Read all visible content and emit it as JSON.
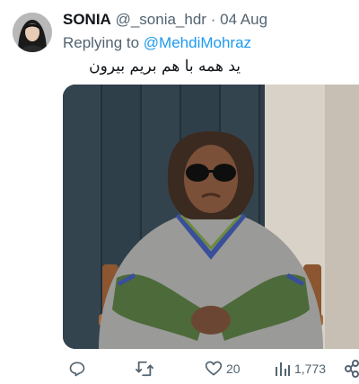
{
  "tweet": {
    "display_name": "SONIA",
    "handle": "@_sonia_hdr",
    "separator": "·",
    "date": "04 Aug",
    "replying_prefix": "Replying to",
    "replying_to": "@MehdiMohraz",
    "text": "ید همه با هم بریم بیرون",
    "media_icon": "photo-of-person-in-sunglasses-sitting-in-chair"
  },
  "actions": {
    "reply_icon": "reply-icon",
    "retweet_icon": "retweet-icon",
    "like_icon": "heart-icon",
    "like_count": "20",
    "views_icon": "views-icon",
    "views_count": "1,773",
    "share_icon": "share-icon"
  },
  "colors": {
    "accent": "#1d9bf0",
    "secondary_text": "#536471",
    "primary_text": "#0f1419"
  }
}
